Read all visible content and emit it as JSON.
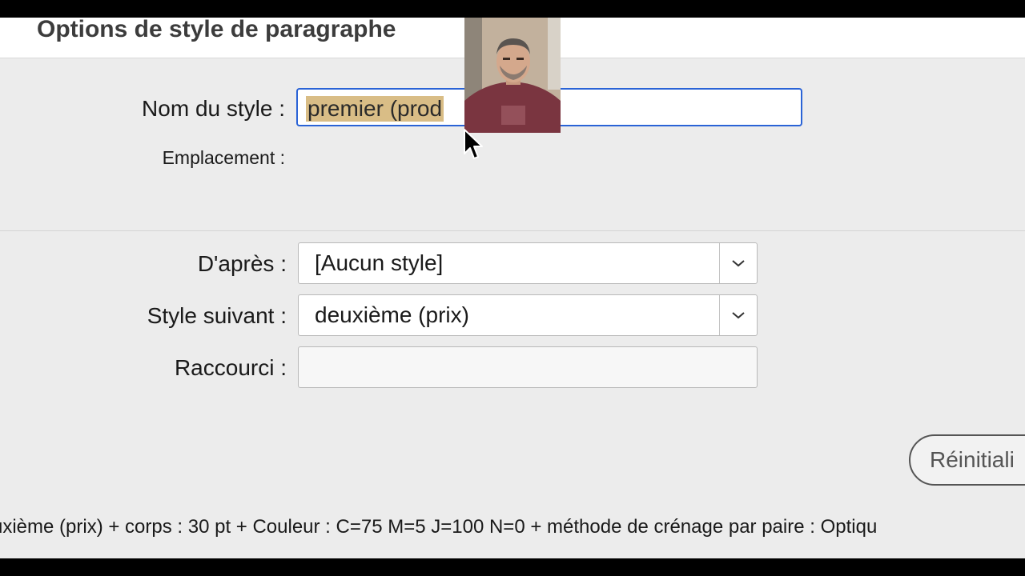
{
  "dialog": {
    "title": "Options de style de paragraphe"
  },
  "general": {
    "name_label": "Nom du style :",
    "name_value": "premier (prod",
    "location_label": "Emplacement :"
  },
  "fields": {
    "based_on_label": "D'après :",
    "based_on_value": "[Aucun style]",
    "next_style_label": "Style suivant :",
    "next_style_value": "deuxième (prix)",
    "shortcut_label": "Raccourci :",
    "shortcut_value": ""
  },
  "buttons": {
    "reset_label": "Réinitiali"
  },
  "summary": {
    "text": "uxième (prix) + corps : 30 pt + Couleur : C=75 M=5 J=100 N=0 + méthode de crénage par paire : Optiqu"
  },
  "icons": {
    "dropdown": "chevron-down-icon",
    "pointer": "mouse-cursor-icon",
    "overlay": "webcam-overlay"
  },
  "colors": {
    "selection_highlight": "#d9bd86",
    "focus_border": "#2a63d6",
    "dialog_bg": "#ececec"
  }
}
